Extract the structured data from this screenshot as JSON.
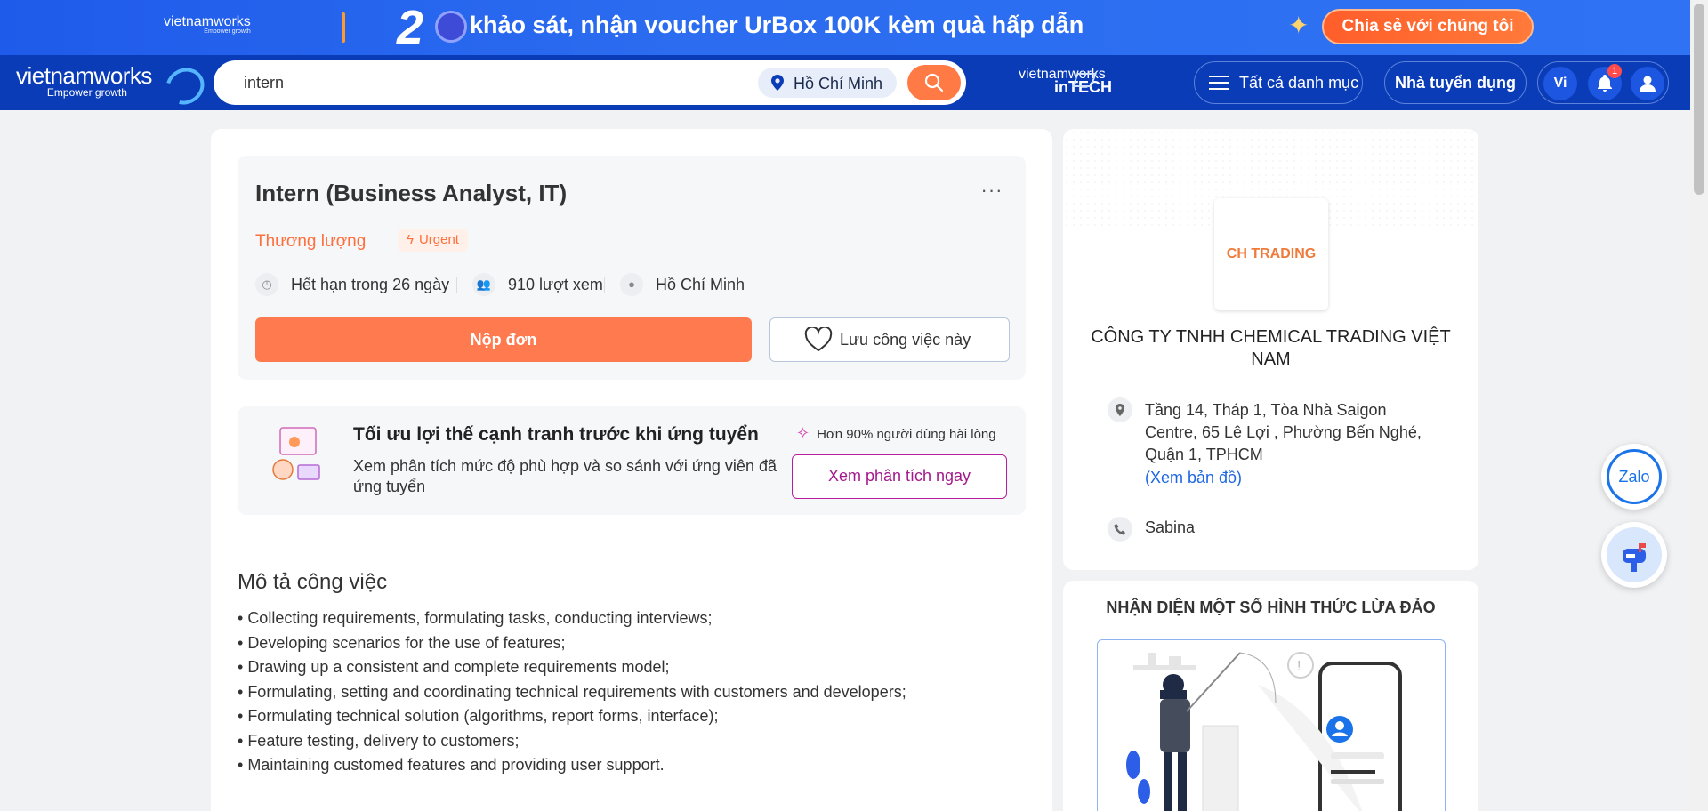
{
  "promo": {
    "logo": "vietnamworks",
    "logo_tag": "Empower growth",
    "number": "2",
    "text": "khảo sát, nhận voucher UrBox 100K kèm quà hấp dẫn",
    "cta": "Chia sẻ với chúng tôi"
  },
  "nav": {
    "brand": "vietnamworks",
    "tagline": "Empower growth",
    "search_value": "intern",
    "location": "Hồ Chí Minh",
    "intech_top": "vietnamworks",
    "intech_bottom": "inTECH",
    "categories": "Tất cả danh mục",
    "employer": "Nhà tuyển dụng",
    "lang": "Vi",
    "notif_count": "1"
  },
  "job": {
    "title": "Intern (Business Analyst, IT)",
    "more": "···",
    "salary": "Thương lượng",
    "urgent": "Urgent",
    "deadline": "Hết hạn trong 26 ngày",
    "views": "910 lượt xem",
    "location": "Hồ Chí Minh",
    "apply": "Nộp đơn",
    "save": "Lưu công việc này"
  },
  "ai_card": {
    "title": "Tối ưu lợi thế cạnh tranh trước khi ứng tuyển",
    "desc": "Xem phân tích mức độ phù hợp và so sánh với ứng viên đã ứng tuyển",
    "satisfaction": "Hơn 90% người dùng hài lòng",
    "button": "Xem phân tích ngay"
  },
  "description": {
    "title": "Mô tả công việc",
    "items": [
      "Collecting requirements, formulating tasks, conducting interviews;",
      "Developing scenarios for the use of features;",
      "Drawing up a consistent and complete requirements model;",
      "Formulating, setting and coordinating technical requirements with customers and developers;",
      "Formulating technical solution (algorithms, report forms, interface);",
      "Feature testing, delivery to customers;",
      "Maintaining customed features and providing user support."
    ]
  },
  "company": {
    "logo_text": "CH TRADING",
    "name": "CÔNG TY TNHH CHEMICAL TRADING VIỆT NAM",
    "address": "Tầng 14, Tháp 1, Tòa Nhà Saigon Centre, 65 Lê Lợi , Phường Bến Nghé, Quận 1, TPHCM",
    "map_link": "(Xem bản đồ)",
    "contact": "Sabina"
  },
  "fraud": {
    "title": "NHẬN DIỆN MỘT SỐ HÌNH THỨC LỪA ĐẢO"
  },
  "floating": {
    "zalo": "Zalo"
  },
  "colors": {
    "brand_blue": "#0a3cb7",
    "accent_orange": "#ff7a4f",
    "ai_magenta": "#a3198b",
    "link_blue": "#1d66e5"
  }
}
